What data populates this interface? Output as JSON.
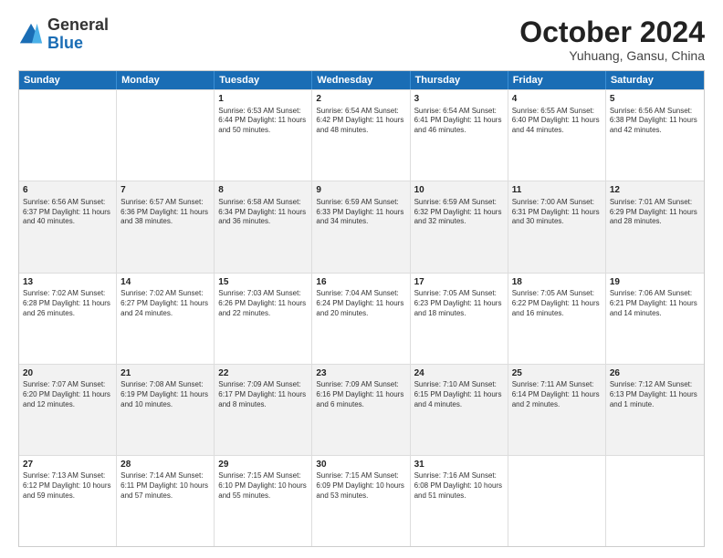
{
  "header": {
    "logo_general": "General",
    "logo_blue": "Blue",
    "month": "October 2024",
    "location": "Yuhuang, Gansu, China"
  },
  "days_of_week": [
    "Sunday",
    "Monday",
    "Tuesday",
    "Wednesday",
    "Thursday",
    "Friday",
    "Saturday"
  ],
  "rows": [
    [
      {
        "day": "",
        "text": ""
      },
      {
        "day": "",
        "text": ""
      },
      {
        "day": "1",
        "text": "Sunrise: 6:53 AM\nSunset: 6:44 PM\nDaylight: 11 hours and 50 minutes."
      },
      {
        "day": "2",
        "text": "Sunrise: 6:54 AM\nSunset: 6:42 PM\nDaylight: 11 hours and 48 minutes."
      },
      {
        "day": "3",
        "text": "Sunrise: 6:54 AM\nSunset: 6:41 PM\nDaylight: 11 hours and 46 minutes."
      },
      {
        "day": "4",
        "text": "Sunrise: 6:55 AM\nSunset: 6:40 PM\nDaylight: 11 hours and 44 minutes."
      },
      {
        "day": "5",
        "text": "Sunrise: 6:56 AM\nSunset: 6:38 PM\nDaylight: 11 hours and 42 minutes."
      }
    ],
    [
      {
        "day": "6",
        "text": "Sunrise: 6:56 AM\nSunset: 6:37 PM\nDaylight: 11 hours and 40 minutes."
      },
      {
        "day": "7",
        "text": "Sunrise: 6:57 AM\nSunset: 6:36 PM\nDaylight: 11 hours and 38 minutes."
      },
      {
        "day": "8",
        "text": "Sunrise: 6:58 AM\nSunset: 6:34 PM\nDaylight: 11 hours and 36 minutes."
      },
      {
        "day": "9",
        "text": "Sunrise: 6:59 AM\nSunset: 6:33 PM\nDaylight: 11 hours and 34 minutes."
      },
      {
        "day": "10",
        "text": "Sunrise: 6:59 AM\nSunset: 6:32 PM\nDaylight: 11 hours and 32 minutes."
      },
      {
        "day": "11",
        "text": "Sunrise: 7:00 AM\nSunset: 6:31 PM\nDaylight: 11 hours and 30 minutes."
      },
      {
        "day": "12",
        "text": "Sunrise: 7:01 AM\nSunset: 6:29 PM\nDaylight: 11 hours and 28 minutes."
      }
    ],
    [
      {
        "day": "13",
        "text": "Sunrise: 7:02 AM\nSunset: 6:28 PM\nDaylight: 11 hours and 26 minutes."
      },
      {
        "day": "14",
        "text": "Sunrise: 7:02 AM\nSunset: 6:27 PM\nDaylight: 11 hours and 24 minutes."
      },
      {
        "day": "15",
        "text": "Sunrise: 7:03 AM\nSunset: 6:26 PM\nDaylight: 11 hours and 22 minutes."
      },
      {
        "day": "16",
        "text": "Sunrise: 7:04 AM\nSunset: 6:24 PM\nDaylight: 11 hours and 20 minutes."
      },
      {
        "day": "17",
        "text": "Sunrise: 7:05 AM\nSunset: 6:23 PM\nDaylight: 11 hours and 18 minutes."
      },
      {
        "day": "18",
        "text": "Sunrise: 7:05 AM\nSunset: 6:22 PM\nDaylight: 11 hours and 16 minutes."
      },
      {
        "day": "19",
        "text": "Sunrise: 7:06 AM\nSunset: 6:21 PM\nDaylight: 11 hours and 14 minutes."
      }
    ],
    [
      {
        "day": "20",
        "text": "Sunrise: 7:07 AM\nSunset: 6:20 PM\nDaylight: 11 hours and 12 minutes."
      },
      {
        "day": "21",
        "text": "Sunrise: 7:08 AM\nSunset: 6:19 PM\nDaylight: 11 hours and 10 minutes."
      },
      {
        "day": "22",
        "text": "Sunrise: 7:09 AM\nSunset: 6:17 PM\nDaylight: 11 hours and 8 minutes."
      },
      {
        "day": "23",
        "text": "Sunrise: 7:09 AM\nSunset: 6:16 PM\nDaylight: 11 hours and 6 minutes."
      },
      {
        "day": "24",
        "text": "Sunrise: 7:10 AM\nSunset: 6:15 PM\nDaylight: 11 hours and 4 minutes."
      },
      {
        "day": "25",
        "text": "Sunrise: 7:11 AM\nSunset: 6:14 PM\nDaylight: 11 hours and 2 minutes."
      },
      {
        "day": "26",
        "text": "Sunrise: 7:12 AM\nSunset: 6:13 PM\nDaylight: 11 hours and 1 minute."
      }
    ],
    [
      {
        "day": "27",
        "text": "Sunrise: 7:13 AM\nSunset: 6:12 PM\nDaylight: 10 hours and 59 minutes."
      },
      {
        "day": "28",
        "text": "Sunrise: 7:14 AM\nSunset: 6:11 PM\nDaylight: 10 hours and 57 minutes."
      },
      {
        "day": "29",
        "text": "Sunrise: 7:15 AM\nSunset: 6:10 PM\nDaylight: 10 hours and 55 minutes."
      },
      {
        "day": "30",
        "text": "Sunrise: 7:15 AM\nSunset: 6:09 PM\nDaylight: 10 hours and 53 minutes."
      },
      {
        "day": "31",
        "text": "Sunrise: 7:16 AM\nSunset: 6:08 PM\nDaylight: 10 hours and 51 minutes."
      },
      {
        "day": "",
        "text": ""
      },
      {
        "day": "",
        "text": ""
      }
    ]
  ]
}
